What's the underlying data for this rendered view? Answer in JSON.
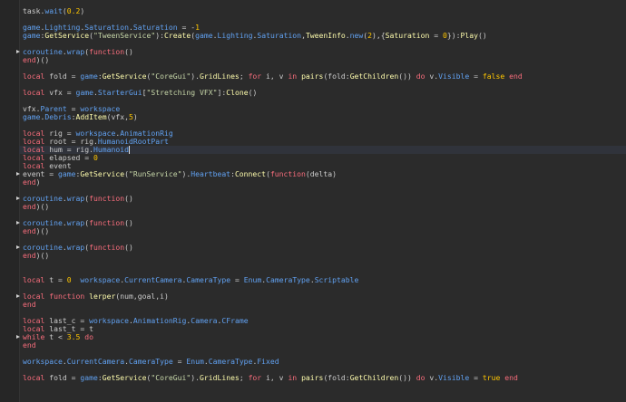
{
  "editor": {
    "current_line": 17,
    "lines": [
      [
        [
          "p",
          "task"
        ],
        [
          "p",
          "."
        ],
        [
          "b",
          "wait"
        ],
        [
          "p",
          "("
        ],
        [
          "n",
          "0.2"
        ],
        [
          "p",
          ")"
        ]
      ],
      [],
      [
        [
          "b",
          "game"
        ],
        [
          "p",
          "."
        ],
        [
          "b",
          "Lighting"
        ],
        [
          "p",
          "."
        ],
        [
          "b",
          "Saturation"
        ],
        [
          "p",
          "."
        ],
        [
          "b",
          "Saturation"
        ],
        [
          "p",
          " = -"
        ],
        [
          "n",
          "1"
        ]
      ],
      [
        [
          "b",
          "game"
        ],
        [
          "p",
          ":"
        ],
        [
          "m",
          "GetService"
        ],
        [
          "p",
          "("
        ],
        [
          "s",
          "\"TweenService\""
        ],
        [
          "p",
          ")"
        ],
        [
          "p",
          ":"
        ],
        [
          "m",
          "Create"
        ],
        [
          "p",
          "("
        ],
        [
          "b",
          "game"
        ],
        [
          "p",
          "."
        ],
        [
          "b",
          "Lighting"
        ],
        [
          "p",
          "."
        ],
        [
          "b",
          "Saturation"
        ],
        [
          "p",
          ","
        ],
        [
          "m",
          "TweenInfo"
        ],
        [
          "p",
          "."
        ],
        [
          "b",
          "new"
        ],
        [
          "p",
          "("
        ],
        [
          "n",
          "2"
        ],
        [
          "p",
          "),{"
        ],
        [
          "m",
          "Saturation"
        ],
        [
          "p",
          " = "
        ],
        [
          "n",
          "0"
        ],
        [
          "p",
          "}):"
        ],
        [
          "m",
          "Play"
        ],
        [
          "p",
          "()"
        ]
      ],
      [],
      [
        [
          "b",
          "coroutine"
        ],
        [
          "p",
          "."
        ],
        [
          "b",
          "wrap"
        ],
        [
          "p",
          "("
        ],
        [
          "k",
          "function"
        ],
        [
          "p",
          "()"
        ]
      ],
      [
        [
          "k",
          "end"
        ],
        [
          "p",
          ")()"
        ]
      ],
      [],
      [
        [
          "k",
          "local"
        ],
        [
          "p",
          " fold = "
        ],
        [
          "b",
          "game"
        ],
        [
          "p",
          ":"
        ],
        [
          "m",
          "GetService"
        ],
        [
          "p",
          "("
        ],
        [
          "s",
          "\"CoreGui\""
        ],
        [
          "p",
          ")."
        ],
        [
          "m",
          "GridLines"
        ],
        [
          "p",
          "; "
        ],
        [
          "k",
          "for"
        ],
        [
          "p",
          " i, v "
        ],
        [
          "k",
          "in"
        ],
        [
          "p",
          " "
        ],
        [
          "m",
          "pairs"
        ],
        [
          "p",
          "(fold:"
        ],
        [
          "m",
          "GetChildren"
        ],
        [
          "p",
          "()) "
        ],
        [
          "k",
          "do"
        ],
        [
          "p",
          " v."
        ],
        [
          "b",
          "Visible"
        ],
        [
          "p",
          " = "
        ],
        [
          "f",
          "false"
        ],
        [
          "p",
          " "
        ],
        [
          "k",
          "end"
        ]
      ],
      [],
      [
        [
          "k",
          "local"
        ],
        [
          "p",
          " vfx = "
        ],
        [
          "b",
          "game"
        ],
        [
          "p",
          "."
        ],
        [
          "b",
          "StarterGui"
        ],
        [
          "p",
          "["
        ],
        [
          "s",
          "\"Stretching VFX\""
        ],
        [
          "p",
          "]:"
        ],
        [
          "m",
          "Clone"
        ],
        [
          "p",
          "()"
        ]
      ],
      [],
      [
        [
          "p",
          "vfx."
        ],
        [
          "b",
          "Parent"
        ],
        [
          "p",
          " = "
        ],
        [
          "b",
          "workspace"
        ]
      ],
      [
        [
          "b",
          "game"
        ],
        [
          "p",
          "."
        ],
        [
          "b",
          "Debris"
        ],
        [
          "p",
          ":"
        ],
        [
          "m",
          "AddItem"
        ],
        [
          "p",
          "(vfx,"
        ],
        [
          "n",
          "5"
        ],
        [
          "p",
          ")"
        ]
      ],
      [],
      [
        [
          "k",
          "local"
        ],
        [
          "p",
          " rig = "
        ],
        [
          "b",
          "workspace"
        ],
        [
          "p",
          "."
        ],
        [
          "b",
          "AnimationRig"
        ]
      ],
      [
        [
          "k",
          "local"
        ],
        [
          "p",
          " root = rig."
        ],
        [
          "b",
          "HumanoidRootPart"
        ]
      ],
      [
        [
          "k",
          "local"
        ],
        [
          "p",
          " hum = rig."
        ],
        [
          "b",
          "Humanoid"
        ]
      ],
      [
        [
          "k",
          "local"
        ],
        [
          "p",
          " elapsed = "
        ],
        [
          "n",
          "0"
        ]
      ],
      [
        [
          "k",
          "local"
        ],
        [
          "p",
          " event"
        ]
      ],
      [
        [
          "p",
          "event = "
        ],
        [
          "b",
          "game"
        ],
        [
          "p",
          ":"
        ],
        [
          "m",
          "GetService"
        ],
        [
          "p",
          "("
        ],
        [
          "s",
          "\"RunService\""
        ],
        [
          "p",
          ")."
        ],
        [
          "b",
          "Heartbeat"
        ],
        [
          "p",
          ":"
        ],
        [
          "m",
          "Connect"
        ],
        [
          "p",
          "("
        ],
        [
          "k",
          "function"
        ],
        [
          "p",
          "(delta)"
        ]
      ],
      [
        [
          "k",
          "end"
        ],
        [
          "p",
          ")"
        ]
      ],
      [],
      [
        [
          "b",
          "coroutine"
        ],
        [
          "p",
          "."
        ],
        [
          "b",
          "wrap"
        ],
        [
          "p",
          "("
        ],
        [
          "k",
          "function"
        ],
        [
          "p",
          "()"
        ]
      ],
      [
        [
          "k",
          "end"
        ],
        [
          "p",
          ")()"
        ]
      ],
      [],
      [
        [
          "b",
          "coroutine"
        ],
        [
          "p",
          "."
        ],
        [
          "b",
          "wrap"
        ],
        [
          "p",
          "("
        ],
        [
          "k",
          "function"
        ],
        [
          "p",
          "()"
        ]
      ],
      [
        [
          "k",
          "end"
        ],
        [
          "p",
          ")()"
        ]
      ],
      [],
      [
        [
          "b",
          "coroutine"
        ],
        [
          "p",
          "."
        ],
        [
          "b",
          "wrap"
        ],
        [
          "p",
          "("
        ],
        [
          "k",
          "function"
        ],
        [
          "p",
          "()"
        ]
      ],
      [
        [
          "k",
          "end"
        ],
        [
          "p",
          ")()"
        ]
      ],
      [],
      [],
      [
        [
          "k",
          "local"
        ],
        [
          "p",
          " t = "
        ],
        [
          "n",
          "0"
        ],
        [
          "p",
          "  "
        ],
        [
          "b",
          "workspace"
        ],
        [
          "p",
          "."
        ],
        [
          "b",
          "CurrentCamera"
        ],
        [
          "p",
          "."
        ],
        [
          "b",
          "CameraType"
        ],
        [
          "p",
          " = "
        ],
        [
          "b",
          "Enum"
        ],
        [
          "p",
          "."
        ],
        [
          "b",
          "CameraType"
        ],
        [
          "p",
          "."
        ],
        [
          "b",
          "Scriptable"
        ]
      ],
      [],
      [
        [
          "k",
          "local"
        ],
        [
          "p",
          " "
        ],
        [
          "k",
          "function"
        ],
        [
          "p",
          " "
        ],
        [
          "m",
          "lerper"
        ],
        [
          "p",
          "(num,goal,i)"
        ]
      ],
      [
        [
          "k",
          "end"
        ]
      ],
      [],
      [
        [
          "k",
          "local"
        ],
        [
          "p",
          " last_c = "
        ],
        [
          "b",
          "workspace"
        ],
        [
          "p",
          "."
        ],
        [
          "b",
          "AnimationRig"
        ],
        [
          "p",
          "."
        ],
        [
          "b",
          "Camera"
        ],
        [
          "p",
          "."
        ],
        [
          "b",
          "CFrame"
        ]
      ],
      [
        [
          "k",
          "local"
        ],
        [
          "p",
          " last_t = t"
        ]
      ],
      [
        [
          "k",
          "while"
        ],
        [
          "p",
          " t < "
        ],
        [
          "n",
          "3.5"
        ],
        [
          "p",
          " "
        ],
        [
          "k",
          "do"
        ]
      ],
      [
        [
          "k",
          "end"
        ]
      ],
      [],
      [
        [
          "b",
          "workspace"
        ],
        [
          "p",
          "."
        ],
        [
          "b",
          "CurrentCamera"
        ],
        [
          "p",
          "."
        ],
        [
          "b",
          "CameraType"
        ],
        [
          "p",
          " = "
        ],
        [
          "b",
          "Enum"
        ],
        [
          "p",
          "."
        ],
        [
          "b",
          "CameraType"
        ],
        [
          "p",
          "."
        ],
        [
          "b",
          "Fixed"
        ]
      ],
      [],
      [
        [
          "k",
          "local"
        ],
        [
          "p",
          " fold = "
        ],
        [
          "b",
          "game"
        ],
        [
          "p",
          ":"
        ],
        [
          "m",
          "GetService"
        ],
        [
          "p",
          "("
        ],
        [
          "s",
          "\"CoreGui\""
        ],
        [
          "p",
          ")."
        ],
        [
          "m",
          "GridLines"
        ],
        [
          "p",
          "; "
        ],
        [
          "k",
          "for"
        ],
        [
          "p",
          " i, v "
        ],
        [
          "k",
          "in"
        ],
        [
          "p",
          " "
        ],
        [
          "m",
          "pairs"
        ],
        [
          "p",
          "(fold:"
        ],
        [
          "m",
          "GetChildren"
        ],
        [
          "p",
          "()) "
        ],
        [
          "k",
          "do"
        ],
        [
          "p",
          " v."
        ],
        [
          "b",
          "Visible"
        ],
        [
          "p",
          " = "
        ],
        [
          "f",
          "true"
        ],
        [
          "p",
          " "
        ],
        [
          "k",
          "end"
        ]
      ]
    ],
    "fold_rows": [
      5,
      20,
      23,
      26,
      29,
      35,
      40
    ]
  }
}
